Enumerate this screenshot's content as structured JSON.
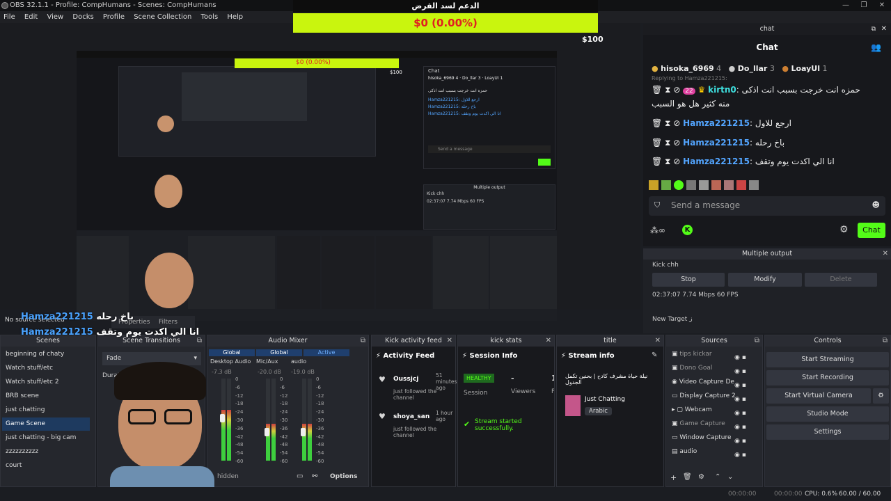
{
  "app": {
    "title": "OBS 32.1.1 - Profile: CompHumans - Scenes: CompHumans",
    "window_controls": [
      "—",
      "❐",
      "✕"
    ]
  },
  "menu": [
    "File",
    "Edit",
    "View",
    "Docks",
    "Profile",
    "Scene Collection",
    "Tools",
    "Help"
  ],
  "overlay": {
    "banner_title": "الدعم لسد القرض",
    "banner_value": "$0 (0.00%)",
    "goal": "$100",
    "mini_banner_value": "$0 (0.00%)",
    "mini_goal": "$100"
  },
  "chat_dock": {
    "dock_title": "chat",
    "header": "Chat",
    "leaderboard": [
      {
        "rank": "1",
        "name": "hisoka_6969",
        "count": "4"
      },
      {
        "rank": "2",
        "name": "Do_llar",
        "count": "3"
      },
      {
        "rank": "3",
        "name": "LoayUl",
        "count": "1"
      }
    ],
    "reply_to": "Replying to Hamza221215:",
    "badge_num": "22",
    "messages": [
      {
        "user": "kirtn0",
        "text": "حمزه انت خرجت بسبب انت اذكى",
        "text2": "منه كثير هل هو السبب"
      },
      {
        "user": "Hamza221215",
        "text": "ارجع للاول"
      },
      {
        "user": "Hamza221215",
        "text": "باخ رحله"
      },
      {
        "user": "Hamza221215",
        "text": "انا الي اكدت يوم وتقف"
      }
    ],
    "input_placeholder": "Send a message",
    "chat_button": "Chat"
  },
  "multiple_output": {
    "dock_title": "Multiple output",
    "target_name": "Kick chh",
    "stop": "Stop",
    "modify": "Modify",
    "delete": "Delete",
    "stats": "02:37:07  7.74 Mbps  60 FPS",
    "new_target": "New Target ز"
  },
  "overlay_captions": {
    "user": "Hamza221215",
    "line1": "باخ رحله",
    "line2": "انا الي اكدت يوم وتقف",
    "no_source": "No source selected",
    "properties": "Properties",
    "filters": "Filters"
  },
  "docks": {
    "scenes": {
      "title": "Scenes",
      "items": [
        "beginning of chaty",
        "Watch stuff/etc",
        "Watch stuff/etc 2",
        "BRB scene",
        "just chatting",
        "Game Scene",
        "just chatting - big cam",
        "zzzzzzzzzz",
        "court"
      ],
      "selected": "Game Scene"
    },
    "transitions": {
      "title": "Scene Transitions",
      "value": "Fade",
      "duration_label": "Duration"
    },
    "audio_mixer": {
      "title": "Audio Mixer",
      "channels": [
        {
          "tag": "Global",
          "name": "Desktop Audio",
          "db": "-7.3 dB",
          "level": 0.62
        },
        {
          "tag": "Global",
          "name": "Mic/Aux",
          "db": "-20.0 dB",
          "level": 0.45
        },
        {
          "tag": "Active",
          "name": "audio",
          "db": "-19.0 dB",
          "level": 0.45
        }
      ],
      "scale": [
        "0",
        "-6",
        "-12",
        "-18",
        "-24",
        "-30",
        "-36",
        "-42",
        "-48",
        "-54",
        "-60"
      ],
      "hidden_label": "hidden",
      "options": "Options"
    },
    "activity": {
      "title": "Kick activity feed",
      "header": "Activity Feed",
      "items": [
        {
          "user": "Oussjcj",
          "time": "51 minutes ago",
          "action": "just followed the channel"
        },
        {
          "user": "shoya_san",
          "time": "1 hour ago",
          "action": "just followed the channel"
        }
      ]
    },
    "kick_stats": {
      "title": "kick stats",
      "header": "Session Info",
      "health": "HEALTHY",
      "session_label": "Session",
      "viewers_value": "-",
      "viewers_label": "Viewers",
      "extra_value": "1",
      "extra_label": "F",
      "status": "Stream started successfully."
    },
    "title_dock": {
      "title": "title",
      "header": "Stream info",
      "stream_title": "نيلة حياة مشرف كادح | بحنين تكمل الجدول",
      "category": "Just Chatting",
      "language": "Arabic"
    },
    "sources": {
      "title": "Sources",
      "items": [
        "tips kickar",
        "Dono Goal",
        "Video Capture De",
        "Display Capture 2",
        "Webcam",
        "Game Capture",
        "Window Capture",
        "audio"
      ]
    },
    "controls": {
      "title": "Controls",
      "buttons": [
        "Start Streaming",
        "Start Recording",
        "Start Virtual Camera",
        "Studio Mode",
        "Settings"
      ]
    }
  },
  "status": {
    "rec_time": "00:00:00",
    "stream_time": "00:00:00",
    "cpu": "CPU: 0.6%",
    "fps": "60.00 / 60.00 FPS"
  },
  "colors": {
    "kick_green": "#53fc18",
    "banner_yellow": "#c9f50e",
    "accent_blue": "#4a90e2"
  }
}
